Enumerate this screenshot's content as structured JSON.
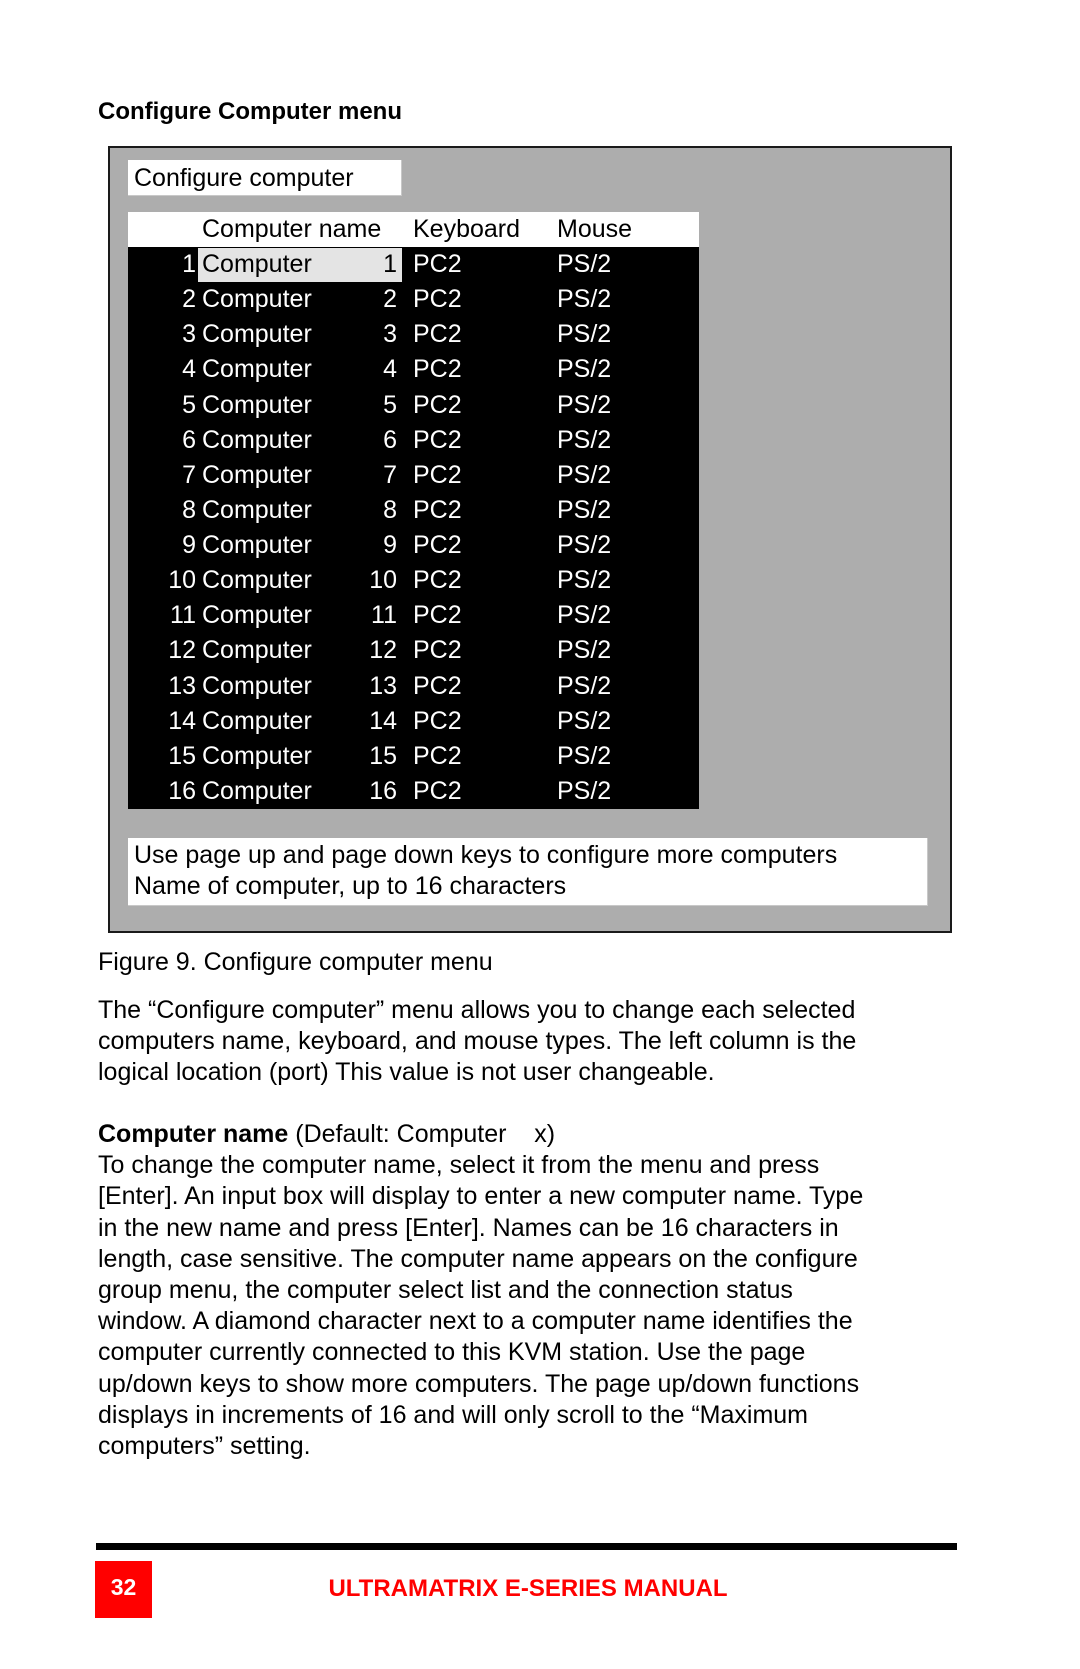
{
  "section_heading": "Configure Computer menu",
  "menu": {
    "title": "Configure computer",
    "columns": {
      "name": "Computer name",
      "keyboard": "Keyboard",
      "mouse": "Mouse"
    },
    "selected_row": 1,
    "rows": [
      {
        "port": "1",
        "name": "Computer",
        "num": "1",
        "keyboard": "PC2",
        "mouse": "PS/2"
      },
      {
        "port": "2",
        "name": "Computer",
        "num": "2",
        "keyboard": "PC2",
        "mouse": "PS/2"
      },
      {
        "port": "3",
        "name": "Computer",
        "num": "3",
        "keyboard": "PC2",
        "mouse": "PS/2"
      },
      {
        "port": "4",
        "name": "Computer",
        "num": "4",
        "keyboard": "PC2",
        "mouse": "PS/2"
      },
      {
        "port": "5",
        "name": "Computer",
        "num": "5",
        "keyboard": "PC2",
        "mouse": "PS/2"
      },
      {
        "port": "6",
        "name": "Computer",
        "num": "6",
        "keyboard": "PC2",
        "mouse": "PS/2"
      },
      {
        "port": "7",
        "name": "Computer",
        "num": "7",
        "keyboard": "PC2",
        "mouse": "PS/2"
      },
      {
        "port": "8",
        "name": "Computer",
        "num": "8",
        "keyboard": "PC2",
        "mouse": "PS/2"
      },
      {
        "port": "9",
        "name": "Computer",
        "num": "9",
        "keyboard": "PC2",
        "mouse": "PS/2"
      },
      {
        "port": "10",
        "name": "Computer",
        "num": "10",
        "keyboard": "PC2",
        "mouse": "PS/2"
      },
      {
        "port": "11",
        "name": "Computer",
        "num": "11",
        "keyboard": "PC2",
        "mouse": "PS/2"
      },
      {
        "port": "12",
        "name": "Computer",
        "num": "12",
        "keyboard": "PC2",
        "mouse": "PS/2"
      },
      {
        "port": "13",
        "name": "Computer",
        "num": "13",
        "keyboard": "PC2",
        "mouse": "PS/2"
      },
      {
        "port": "14",
        "name": "Computer",
        "num": "14",
        "keyboard": "PC2",
        "mouse": "PS/2"
      },
      {
        "port": "15",
        "name": "Computer",
        "num": "15",
        "keyboard": "PC2",
        "mouse": "PS/2"
      },
      {
        "port": "16",
        "name": "Computer",
        "num": "16",
        "keyboard": "PC2",
        "mouse": "PS/2"
      }
    ],
    "help": [
      "Use page up and page down keys to configure more computers",
      "Name of computer, up to 16 characters"
    ]
  },
  "caption": "Figure 9. Configure computer menu",
  "paragraph1": [
    "The “Configure computer” menu allows you to change each selected",
    "computers name, keyboard, and mouse types.  The left column is the",
    "logical location (port)  This value is not user changeable."
  ],
  "computer_name_section": {
    "label": "Computer name",
    "default_text": " (Default: Computer    x)",
    "lines": [
      "To change the computer name, select it from the menu and press",
      "[Enter].  An input box will display to enter a new computer name.  Type",
      "in the new name and press [Enter].  Names can be 16 characters in",
      "length, case sensitive.  The computer name appears on the configure",
      "group menu, the computer select list and the connection status",
      "window.  A diamond character next to a computer name identifies the",
      "computer currently connected to this KVM station.  Use the page",
      "up/down keys to show more computers.  The page up/down functions",
      "displays in increments of 16 and will only scroll to the “Maximum",
      "computers” setting."
    ]
  },
  "footer": {
    "page_number": "32",
    "title": "ULTRAMATRIX E-SERIES MANUAL",
    "accent_color": "#ff0000"
  }
}
